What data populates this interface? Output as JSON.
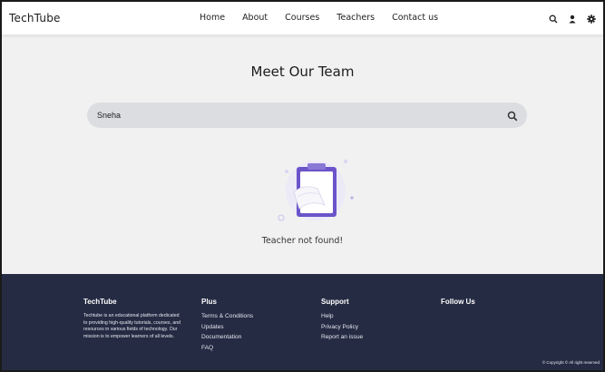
{
  "header": {
    "logo": "TechTube",
    "nav": [
      "Home",
      "About",
      "Courses",
      "Teachers",
      "Contact us"
    ],
    "icons": [
      "search-icon",
      "user-icon",
      "settings-icon"
    ]
  },
  "main": {
    "title": "Meet Our Team",
    "search_value": "Sneha",
    "empty_message": "Teacher not found!"
  },
  "footer": {
    "brand": "TechTube",
    "description": "Techtube is an educational platform dedicated to providing high-quality tutorials, courses, and resources in various fields of technology. Our mission is to empower learners of all levels.",
    "plus": {
      "heading": "Plus",
      "links": [
        "Terms & Conditions",
        "Updates",
        "Documentation",
        "FAQ"
      ]
    },
    "support": {
      "heading": "Support",
      "links": [
        "Help",
        "Privacy Policy",
        "Report an issue"
      ]
    },
    "follow": {
      "heading": "Follow Us"
    },
    "copyright": "© Copyright © All right reserved"
  },
  "colors": {
    "footer_bg": "#252b43",
    "accent_purple": "#6b54c9",
    "search_bg": "#dcdde0"
  }
}
